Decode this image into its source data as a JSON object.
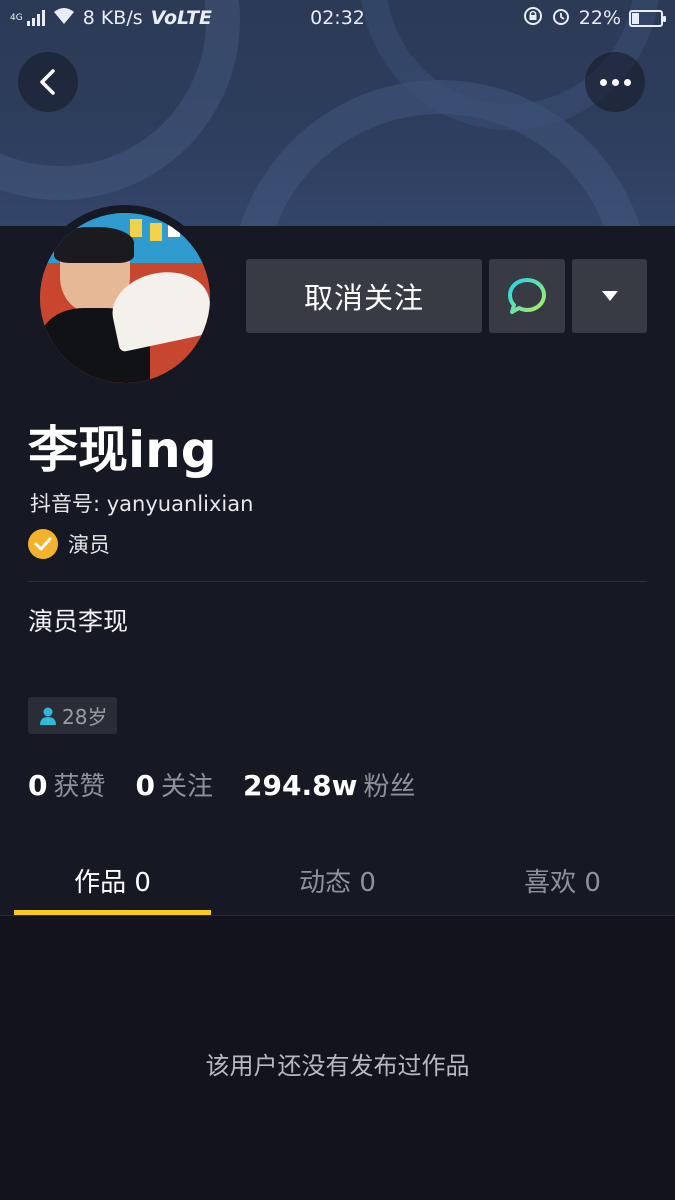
{
  "status_bar": {
    "network_type": "4G",
    "speed": "8 KB/s",
    "volte": "VoLTE",
    "time": "02:32",
    "battery": "22%",
    "battery_level": 0.22
  },
  "profile": {
    "name": "李现ing",
    "douyin_id": "抖音号: yanyuanlixian",
    "verified_label": "演员",
    "bio": "演员李现",
    "age_tag": "28岁"
  },
  "actions": {
    "unfollow_label": "取消关注"
  },
  "stats": [
    {
      "num": "0",
      "label": "获赞"
    },
    {
      "num": "0",
      "label": "关注"
    },
    {
      "num": "294.8w",
      "label": "粉丝"
    }
  ],
  "tabs": [
    {
      "label": "作品 0",
      "active": true
    },
    {
      "label": "动态 0",
      "active": false
    },
    {
      "label": "喜欢 0",
      "active": false
    }
  ],
  "empty_message": "该用户还没有发布过作品",
  "colors": {
    "background": "#161823",
    "button": "#393b44",
    "accent_underline": "#fac81e",
    "verified_badge": "#f4b12a",
    "message_icon_gradient": [
      "#20d5ec",
      "#b0f060"
    ]
  }
}
